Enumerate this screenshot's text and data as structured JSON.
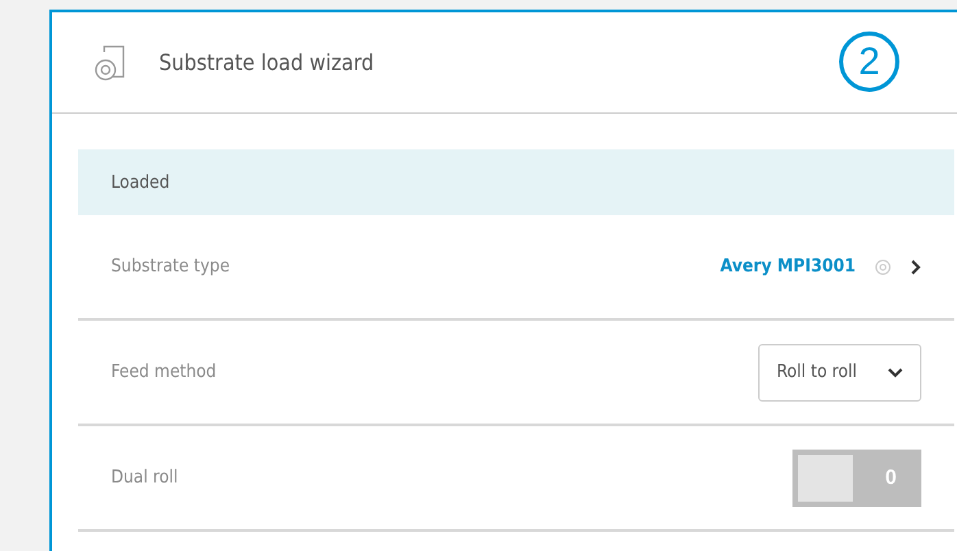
{
  "header": {
    "title": "Substrate load wizard",
    "step_badge": "2"
  },
  "status": {
    "label": "Loaded"
  },
  "rows": [
    {
      "kind": "link",
      "label": "Substrate type",
      "value": "Avery MPI3001"
    },
    {
      "kind": "select",
      "label": "Feed method",
      "value": "Roll to roll"
    },
    {
      "kind": "toggle",
      "label": "Dual roll",
      "on": false,
      "value": "0"
    }
  ]
}
